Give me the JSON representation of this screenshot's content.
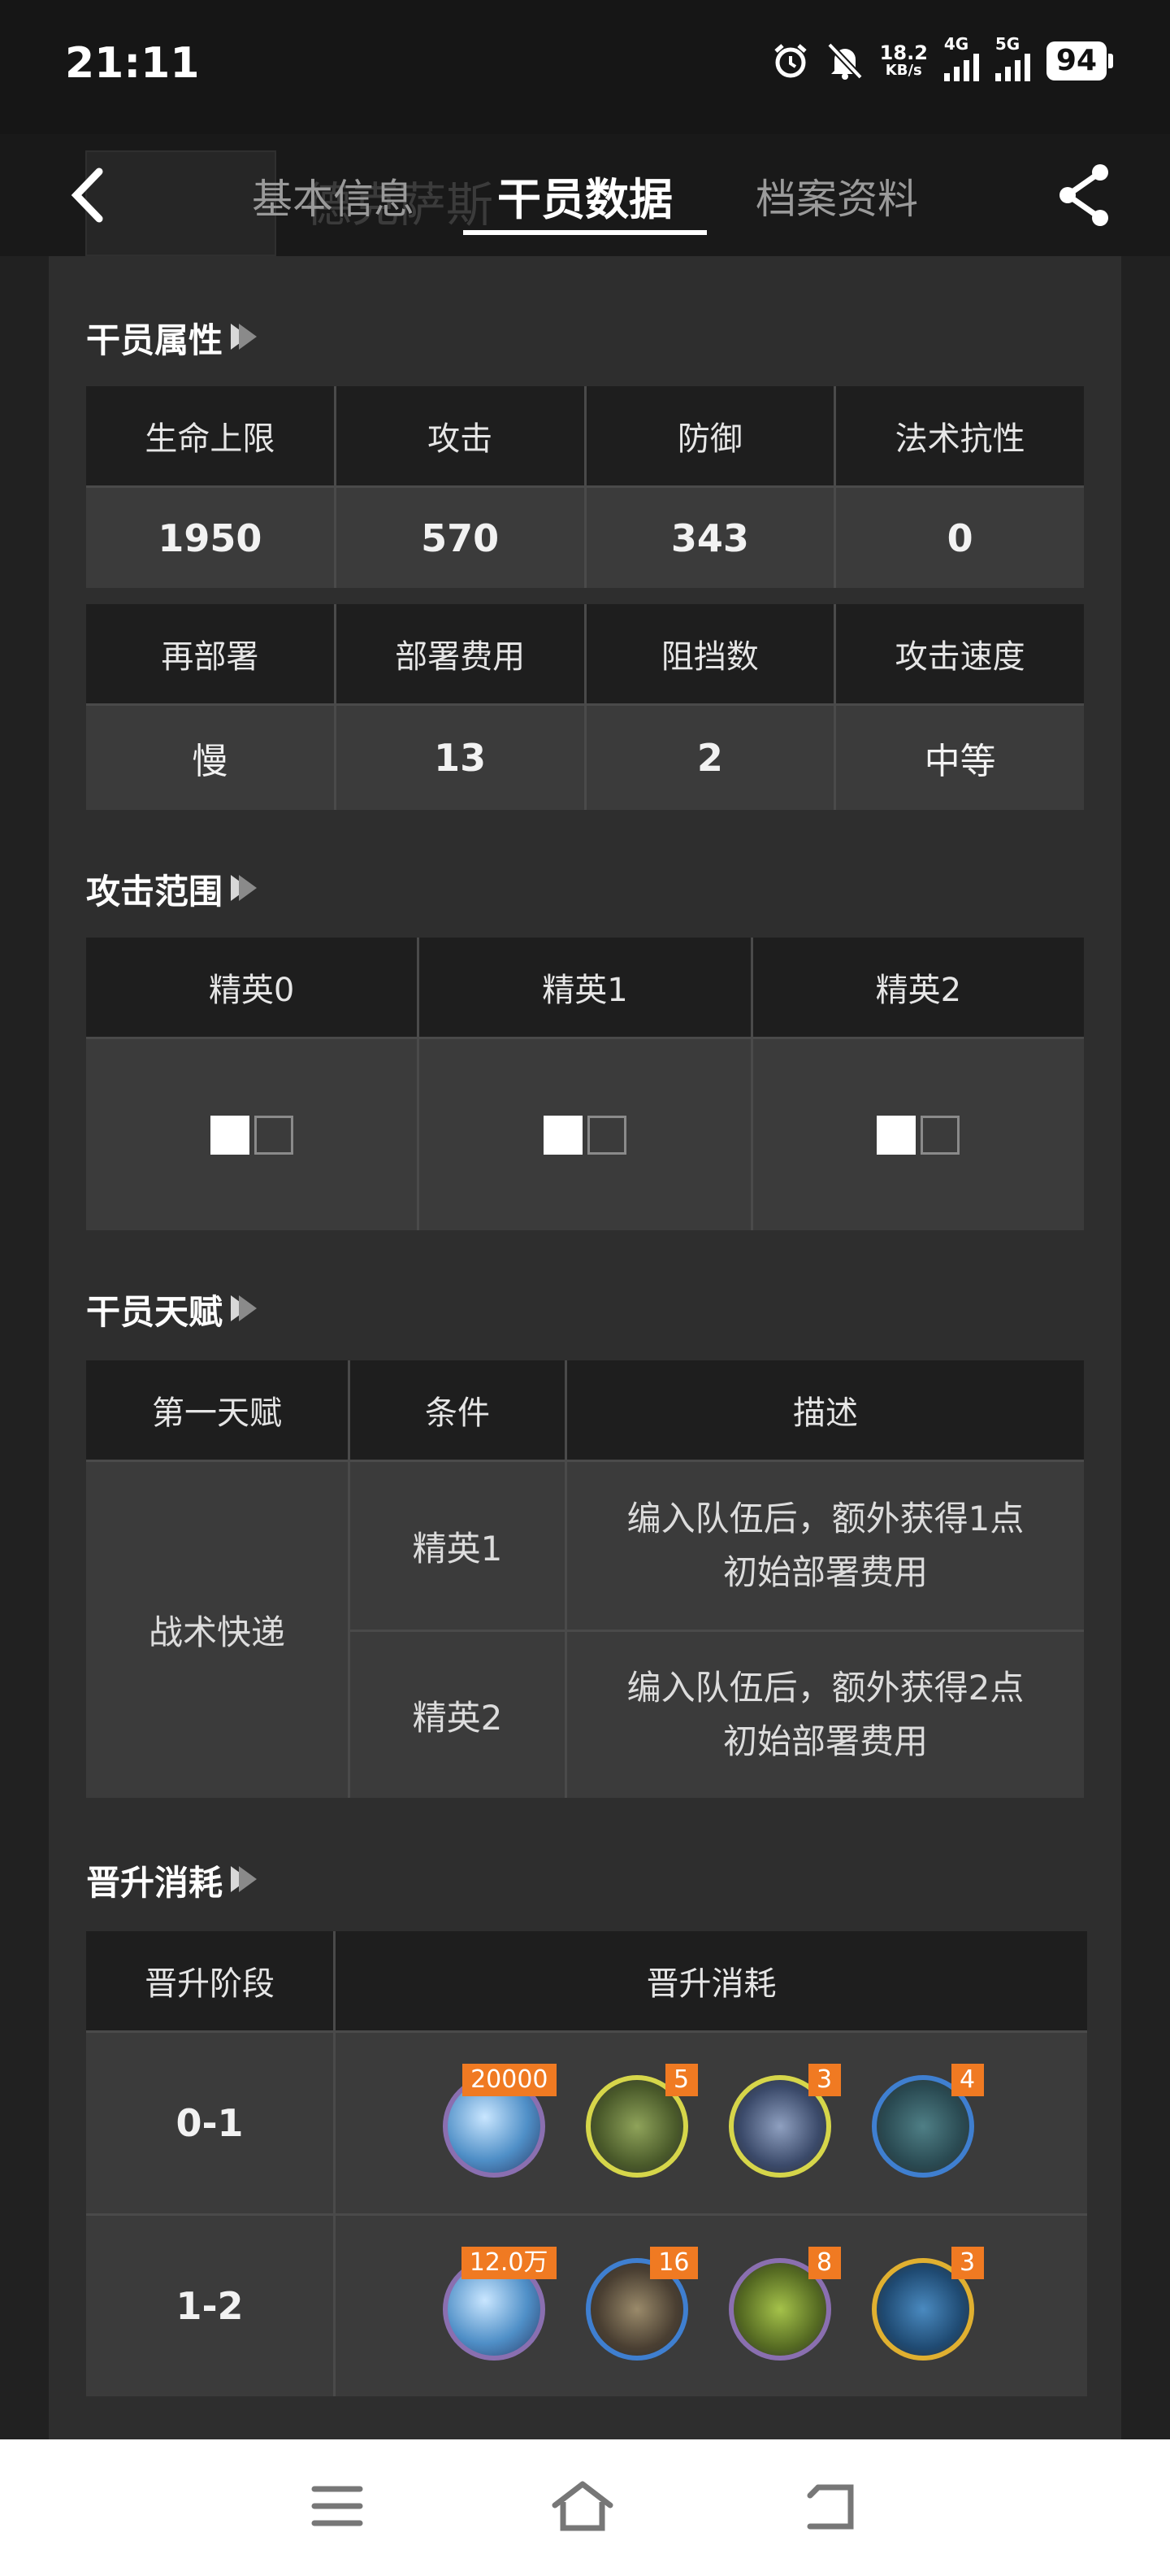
{
  "status_bar": {
    "time": "21:11",
    "net_speed": "18.2",
    "net_unit": "KB/s",
    "sim1": "4G",
    "sim2": "5G",
    "battery": "94"
  },
  "header": {
    "background_name": "德克萨斯",
    "tabs": [
      {
        "label": "基本信息",
        "active": false
      },
      {
        "label": "干员数据",
        "active": true
      },
      {
        "label": "档案资料",
        "active": false
      }
    ]
  },
  "attributes": {
    "title": "干员属性",
    "row1_headers": [
      "生命上限",
      "攻击",
      "防御",
      "法术抗性"
    ],
    "row1_values": [
      "1950",
      "570",
      "343",
      "0"
    ],
    "row2_headers": [
      "再部署",
      "部署费用",
      "阻挡数",
      "攻击速度"
    ],
    "row2_values": [
      "慢",
      "13",
      "2",
      "中等"
    ]
  },
  "range": {
    "title": "攻击范围",
    "headers": [
      "精英0",
      "精英1",
      "精英2"
    ]
  },
  "talent": {
    "title": "干员天赋",
    "headers": [
      "第一天赋",
      "条件",
      "描述"
    ],
    "name": "战术快递",
    "rows": [
      {
        "condition": "精英1",
        "desc_line1": "编入队伍后，额外获得1点",
        "desc_line2": "初始部署费用"
      },
      {
        "condition": "精英2",
        "desc_line1": "编入队伍后，额外获得2点",
        "desc_line2": "初始部署费用"
      }
    ]
  },
  "promotion": {
    "title": "晋升消耗",
    "headers": [
      "晋升阶段",
      "晋升消耗"
    ],
    "rows": [
      {
        "stage": "0-1",
        "items": [
          {
            "icon": "lmd-icon",
            "count": "20000",
            "ring": "#8a6fb0"
          },
          {
            "icon": "chip-icon",
            "count": "5",
            "ring": "#d6d64a"
          },
          {
            "icon": "chip-pack-icon",
            "count": "3",
            "ring": "#d6d64a"
          },
          {
            "icon": "chip-blue-icon",
            "count": "4",
            "ring": "#3f7fd0"
          }
        ]
      },
      {
        "stage": "1-2",
        "items": [
          {
            "icon": "lmd-icon",
            "count": "12.0万",
            "ring": "#8a6fb0"
          },
          {
            "icon": "ore-icon",
            "count": "16",
            "ring": "#3f7fd0"
          },
          {
            "icon": "device-icon",
            "count": "8",
            "ring": "#8a6fb0"
          },
          {
            "icon": "dualchip-icon",
            "count": "3",
            "ring": "#e0b030"
          }
        ]
      }
    ]
  },
  "colors": {
    "badge": "#f07a22",
    "background": "#212121",
    "header_cell": "#1e1e1e",
    "value_cell": "#3b3b3b"
  }
}
